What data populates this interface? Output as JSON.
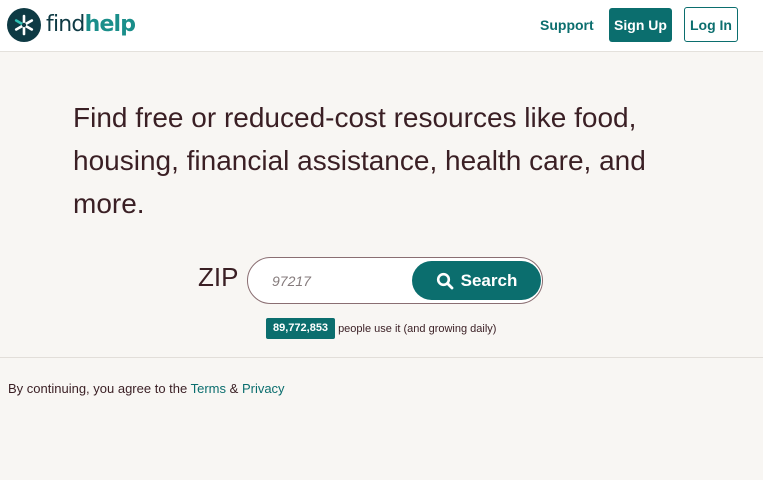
{
  "header": {
    "logo": {
      "find": "find",
      "help": "help",
      "icon": "findhelp-logo-icon"
    },
    "nav": {
      "support": "Support",
      "sign_up": "Sign Up",
      "log_in": "Log In"
    }
  },
  "hero": {
    "headline": "Find free or reduced-cost resources like food, housing, financial assistance, health care, and more."
  },
  "search": {
    "zip_label": "ZIP",
    "zip_placeholder": "97217",
    "button_label": "Search",
    "button_icon": "search-icon"
  },
  "stats": {
    "user_count": "89,772,853",
    "user_text": "people use it (and growing daily)"
  },
  "footer": {
    "prefix": "By continuing, you agree to the",
    "terms": "Terms",
    "ampersand": "&",
    "privacy": "Privacy"
  },
  "colors": {
    "primary": "#0b6e6e",
    "logo_dark": "#0e3a44",
    "logo_teal": "#1a8e8a",
    "background": "#f8f6f3",
    "text": "#3a1f24"
  }
}
